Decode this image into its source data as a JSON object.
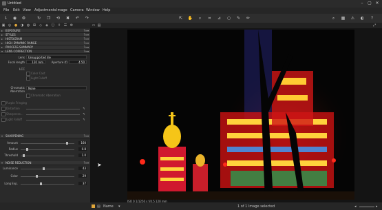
{
  "window": {
    "title": "Untitled"
  },
  "menu": [
    "File",
    "Edit",
    "View",
    "Adjustments",
    "Image",
    "Camera",
    "Window",
    "Help"
  ],
  "panel": {
    "sections": [
      {
        "label": "EXPOSURE"
      },
      {
        "label": "STYLES"
      },
      {
        "label": "HISTOGRAM"
      },
      {
        "label": "HIGH DYNAMIC RANGE"
      },
      {
        "label": "PROCESS SUMMARY"
      },
      {
        "label": "LENS CORRECTION"
      }
    ],
    "lens": {
      "lens_label": "Lens",
      "lens_value": "Unsupported lile",
      "focal_label": "Focal length",
      "focal_value": "120 mm",
      "aperture_label": "Aperture (f)",
      "aperture_value": "4.50",
      "lcc_label": "LCC",
      "color_cast": "Color Cast",
      "light_falloff": "Light Falloff",
      "chromatic_label": "Chromatic Aberration",
      "chromatic_value": "None",
      "chromatic_check": "Chromatic Aberration",
      "purple_fringing": "Purple Fringing",
      "distortion": "Distortion",
      "sharpness": "Sharpness...",
      "light_falloff2": "Light Falloff"
    },
    "sharpening": {
      "label": "SHARPENING",
      "amount_label": "Amount",
      "amount": "160",
      "radius_label": "Radius",
      "radius": "0.8",
      "threshold_label": "Threshold",
      "threshold": "1.0"
    },
    "noise": {
      "label": "NOISE REDUCTION",
      "luminance_label": "Luminance",
      "luminance": "43",
      "color_label": "Color",
      "color": "29",
      "longexp_label": "Long Exp.",
      "longexp": "37"
    }
  },
  "viewer": {
    "info": "ISO 0   1/1250 s   f/4.5   120 mm",
    "status": "1 of 1 Image selected"
  },
  "statusbar": {
    "sort_label": "Name"
  },
  "icons": {
    "cursor": "arrow-cursor-icon"
  }
}
